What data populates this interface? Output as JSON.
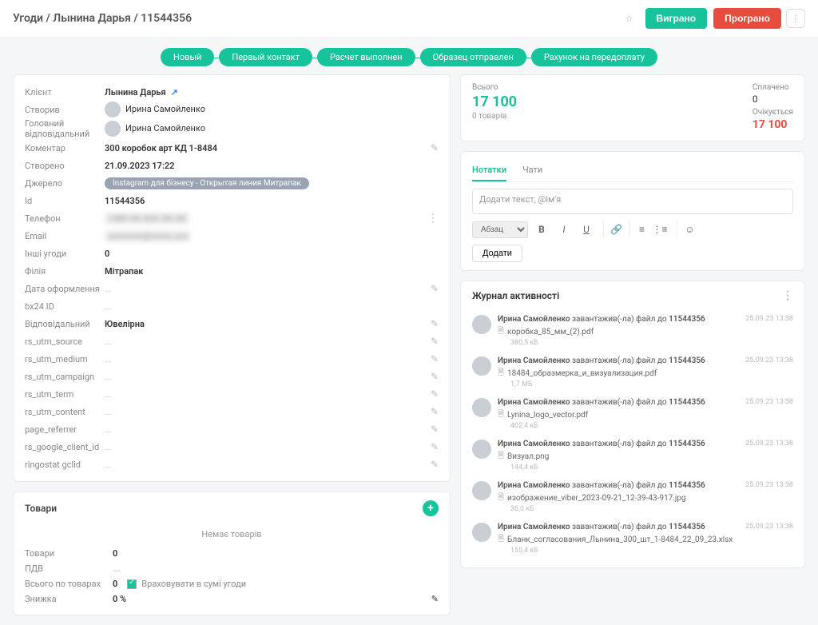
{
  "header": {
    "breadcrumb": "Угоди / Лынина Дарья / 11544356",
    "win": "Виграно",
    "lose": "Програно"
  },
  "pipeline": [
    "Новый",
    "Первый контакт",
    "Расчет выполнен",
    "Образец отправлен",
    "Рахунок на передоплату"
  ],
  "info": {
    "client_lbl": "Клієнт",
    "client_val": "Лынина Дарья",
    "created_by_lbl": "Створив",
    "created_by_val": "Ирина Самойленко",
    "responsible_lbl": "Головний відповідальний",
    "responsible_val": "Ирина Самойленко",
    "comment_lbl": "Коментар",
    "comment_val": "300 коробок арт КД 1-8484",
    "created_at_lbl": "Створено",
    "created_at_val": "21.09.2023 17:22",
    "source_lbl": "Джерело",
    "source_val": "Instagram для бізнесу - Открытая линия Митрапак",
    "id_lbl": "Id",
    "id_val": "11544356",
    "phone_lbl": "Телефон",
    "phone_val": "+380 XX XXX XX XX",
    "email_lbl": "Email",
    "email_val": "xxxxxxxx@xxxxx.xxx",
    "other_lbl": "Інші угоди",
    "other_val": "0",
    "branch_lbl": "Філія",
    "branch_val": "Мітрапак",
    "order_date_lbl": "Дата оформлення",
    "order_date_val": "...",
    "bx24_lbl": "bx24 ID",
    "bx24_val": "...",
    "dept_lbl": "Відповідальний",
    "dept_val": "Ювелірна",
    "utm_source_lbl": "rs_utm_source",
    "utm_source_val": "...",
    "utm_medium_lbl": "rs_utm_medium",
    "utm_medium_val": "...",
    "utm_campaign_lbl": "rs_utm_campaign",
    "utm_campaign_val": "...",
    "utm_term_lbl": "rs_utm_term",
    "utm_term_val": "...",
    "utm_content_lbl": "rs_utm_content",
    "utm_content_val": "...",
    "page_ref_lbl": "page_referrer",
    "page_ref_val": "...",
    "gclient_lbl": "rs_google_client_id",
    "gclient_val": "...",
    "ringo_lbl": "ringostat gclid",
    "ringo_val": "..."
  },
  "products": {
    "title": "Товари",
    "empty": "Немає товарів",
    "rows": {
      "goods_lbl": "Товари",
      "goods_val": "0",
      "vat_lbl": "ПДВ",
      "vat_val": "...",
      "total_lbl": "Всього по товарах",
      "total_val": "0",
      "total_hint": "Враховувати в сумі угоди",
      "disc_lbl": "Знижка",
      "disc_val": "0 %"
    }
  },
  "totals": {
    "all_lbl": "Всього",
    "all_val": "17 100",
    "all_sub": "0 товарів",
    "paid_lbl": "Сплачено",
    "paid_val": "0",
    "wait_lbl": "Очікується",
    "wait_val": "17 100"
  },
  "notes": {
    "tab_notes": "Нотатки",
    "tab_chats": "Чати",
    "placeholder": "Додати текст, @ім'я",
    "format": "Абзац",
    "add": "Додати"
  },
  "activity": {
    "title": "Журнал активності",
    "items": [
      {
        "user": "Ирина Самойленко",
        "action": "завантажив(-ла) файл до",
        "target": "11544356",
        "file": "коробка_85_мм_(2).pdf",
        "size": "380,5 кБ",
        "ts": "25.09.23 13:38"
      },
      {
        "user": "Ирина Самойленко",
        "action": "завантажив(-ла) файл до",
        "target": "11544356",
        "file": "18484_образмерка_и_визуализация.pdf",
        "size": "1,7 МБ",
        "ts": "25.09.23 13:38"
      },
      {
        "user": "Ирина Самойленко",
        "action": "завантажив(-ла) файл до",
        "target": "11544356",
        "file": "Lynina_logo_vector.pdf",
        "size": "402,4 кБ",
        "ts": "25.09.23 13:38"
      },
      {
        "user": "Ирина Самойленко",
        "action": "завантажив(-ла) файл до",
        "target": "11544356",
        "file": "Визуал.png",
        "size": "144,4 кБ",
        "ts": "25.09.23 13:38"
      },
      {
        "user": "Ирина Самойленко",
        "action": "завантажив(-ла) файл до",
        "target": "11544356",
        "file": "изображение_viber_2023-09-21_12-39-43-917.jpg",
        "size": "36,0 кБ",
        "ts": "25.09.23 13:38"
      },
      {
        "user": "Ирина Самойленко",
        "action": "завантажив(-ла) файл до",
        "target": "11544356",
        "file": "Бланк_согласования_Лынина_300_шт_1-8484_22_09_23.xlsx",
        "size": "155,4 кБ",
        "ts": "25.09.23 13:38"
      }
    ]
  }
}
